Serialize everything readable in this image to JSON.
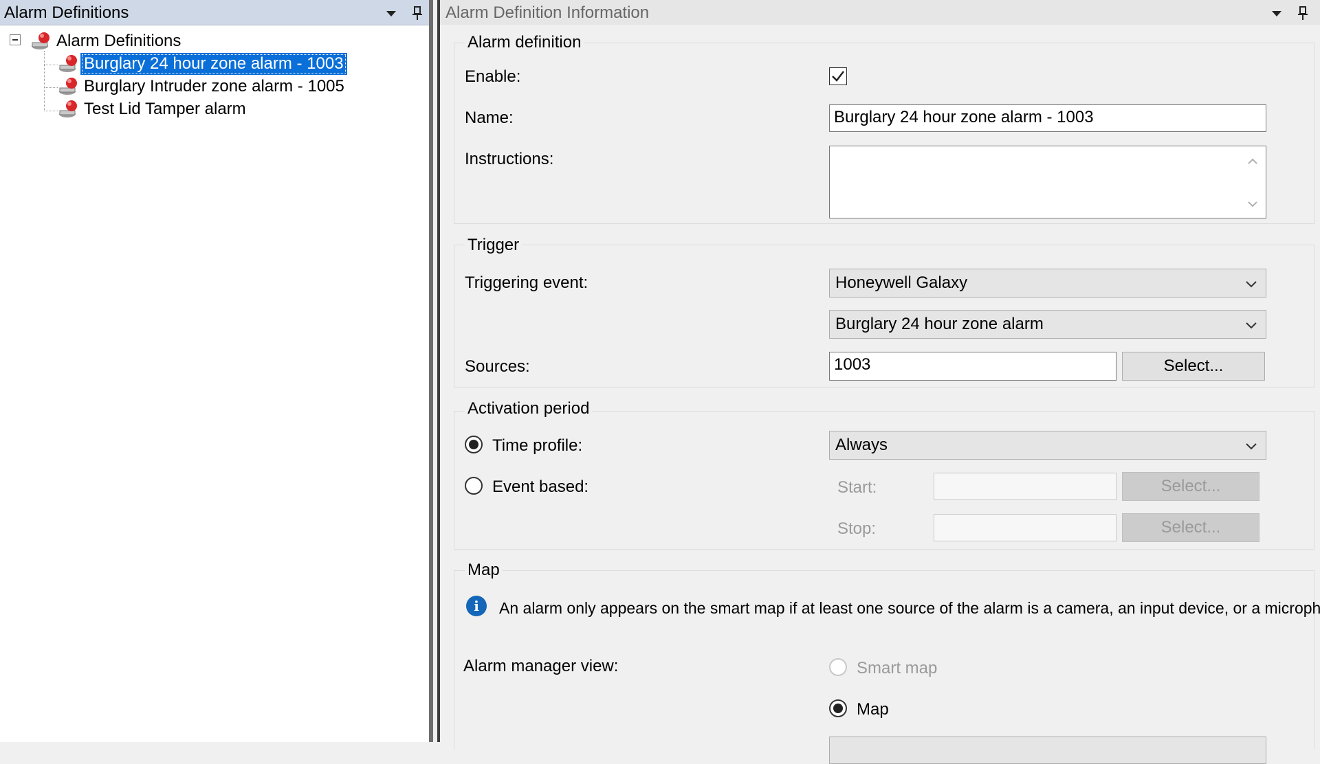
{
  "left_pane": {
    "title": "Alarm Definitions",
    "tree": {
      "root_label": "Alarm Definitions",
      "items": [
        {
          "label": "Burglary 24 hour zone alarm - 1003",
          "selected": true
        },
        {
          "label": "Burglary Intruder zone alarm - 1005",
          "selected": false
        },
        {
          "label": "Test Lid Tamper alarm",
          "selected": false
        }
      ]
    }
  },
  "right_pane": {
    "title": "Alarm Definition Information",
    "alarm_definition": {
      "group_title": "Alarm definition",
      "enable_label": "Enable:",
      "enable_checked": true,
      "name_label": "Name:",
      "name_value": "Burglary 24 hour zone alarm - 1003",
      "instructions_label": "Instructions:",
      "instructions_value": ""
    },
    "trigger": {
      "group_title": "Trigger",
      "triggering_event_label": "Triggering event:",
      "event_source_value": "Honeywell Galaxy",
      "event_type_value": "Burglary 24 hour zone alarm",
      "sources_label": "Sources:",
      "sources_value": "1003",
      "select_button": "Select..."
    },
    "activation_period": {
      "group_title": "Activation period",
      "time_profile_label": "Time profile:",
      "time_profile_value": "Always",
      "event_based_label": "Event based:",
      "start_label": "Start:",
      "stop_label": "Stop:",
      "start_select_button": "Select...",
      "stop_select_button": "Select..."
    },
    "map": {
      "group_title": "Map",
      "info_text": "An alarm only appears on the smart map if at least one source of the alarm is a camera, an input device, or a microphone.",
      "alarm_manager_view_label": "Alarm manager view:",
      "smart_map_label": "Smart map",
      "map_label": "Map"
    }
  },
  "colors": {
    "selection": "#0a6fd8",
    "info_icon": "#1466b8",
    "alarm_icon_red": "#d8262a"
  }
}
